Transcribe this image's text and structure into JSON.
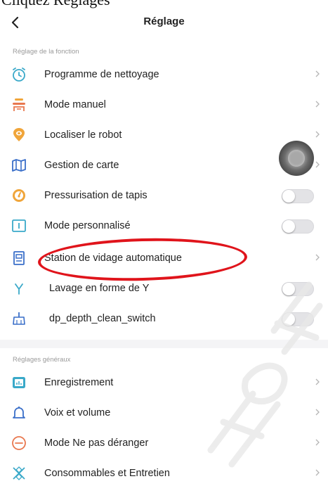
{
  "caption": "Cliquez Reglages",
  "header": {
    "title": "Réglage"
  },
  "sections": {
    "function": "Réglage de la fonction",
    "general": "Réglages généraux"
  },
  "rows": [
    {
      "label": "Programme de nettoyage",
      "icon": "alarm-clock-icon",
      "control": "chevron"
    },
    {
      "label": "Mode manuel",
      "icon": "manual-joystick-icon",
      "control": "chevron"
    },
    {
      "label": "Localiser le robot",
      "icon": "location-pin-icon",
      "control": "chevron"
    },
    {
      "label": "Gestion de carte",
      "icon": "map-icon",
      "control": "chevron"
    },
    {
      "label": "Pressurisation de tapis",
      "icon": "gauge-icon",
      "control": "toggle",
      "on": false
    },
    {
      "label": "Mode personnalisé",
      "icon": "custom-mode-icon",
      "control": "toggle",
      "on": false
    },
    {
      "label": "Station de vidage automatique",
      "icon": "dock-station-icon",
      "control": "chevron"
    },
    {
      "label": "Lavage en forme de Y",
      "icon": "y-path-icon",
      "control": "toggle",
      "on": false
    },
    {
      "label": "dp_depth_clean_switch",
      "icon": "broom-icon",
      "control": "toggle",
      "on": false
    },
    {
      "label": "Enregistrement",
      "icon": "record-chart-icon",
      "control": "chevron"
    },
    {
      "label": "Voix et volume",
      "icon": "bell-icon",
      "control": "chevron"
    },
    {
      "label": "Mode Ne pas déranger",
      "icon": "do-not-disturb-icon",
      "control": "chevron"
    },
    {
      "label": "Consommables et Entretien",
      "icon": "consumables-icon",
      "control": "chevron"
    }
  ],
  "colors": {
    "accent": "#f0a53a",
    "blueIcon": "#3aa9c9",
    "highlight": "#e0141b",
    "toggleOff": "#e3e3e6"
  }
}
